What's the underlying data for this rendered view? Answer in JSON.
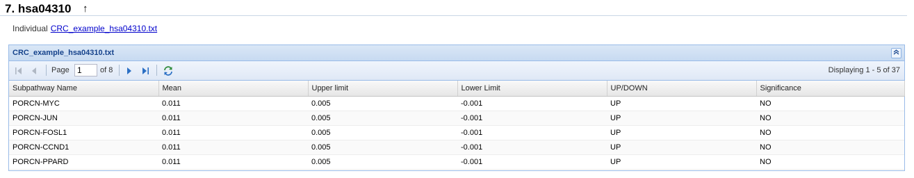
{
  "section": {
    "title": "7. hsa04310",
    "up_arrow": "↑"
  },
  "individual": {
    "label": "Individual",
    "link_text": "CRC_example_hsa04310.txt"
  },
  "panel": {
    "title": "CRC_example_hsa04310.txt"
  },
  "toolbar": {
    "page_label": "Page",
    "page_value": "1",
    "of_label": "of 8",
    "displaying": "Displaying 1 - 5 of 37"
  },
  "columns": [
    "Subpathway Name",
    "Mean",
    "Upper limit",
    "Lower Limit",
    "UP/DOWN",
    "Significance"
  ],
  "rows": [
    [
      "PORCN-MYC",
      "0.011",
      "0.005",
      "-0.001",
      "UP",
      "NO"
    ],
    [
      "PORCN-JUN",
      "0.011",
      "0.005",
      "-0.001",
      "UP",
      "NO"
    ],
    [
      "PORCN-FOSL1",
      "0.011",
      "0.005",
      "-0.001",
      "UP",
      "NO"
    ],
    [
      "PORCN-CCND1",
      "0.011",
      "0.005",
      "-0.001",
      "UP",
      "NO"
    ],
    [
      "PORCN-PPARD",
      "0.011",
      "0.005",
      "-0.001",
      "UP",
      "NO"
    ]
  ]
}
